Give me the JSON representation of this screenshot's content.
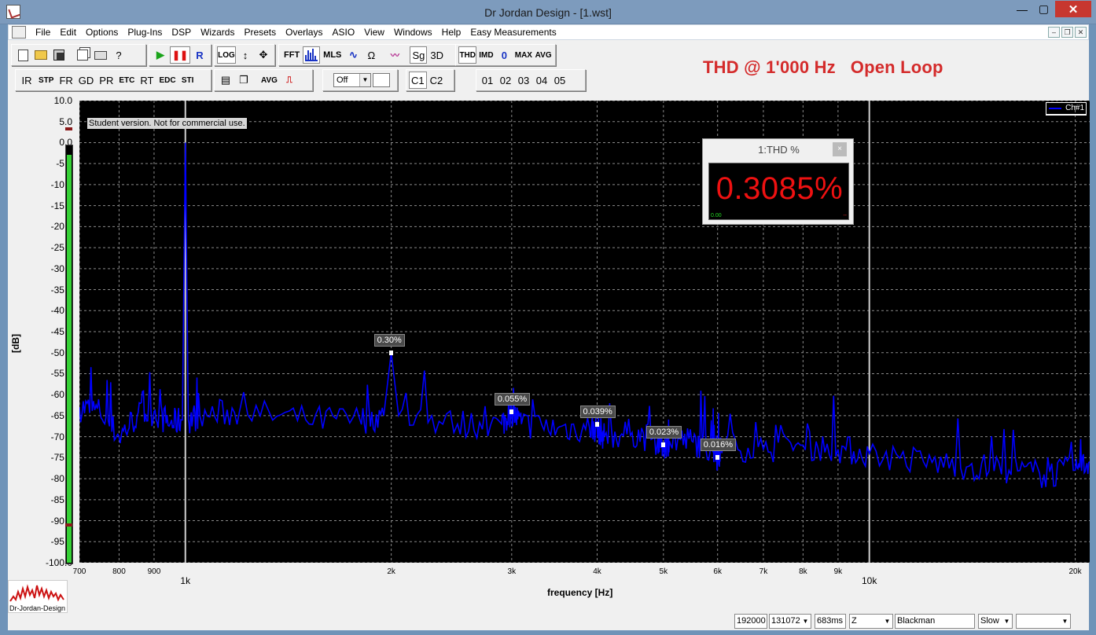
{
  "window": {
    "title": "Dr Jordan Design - [1.wst]",
    "minimize": "—",
    "maximize": "▢",
    "close": "✕"
  },
  "menu": [
    "File",
    "Edit",
    "Options",
    "Plug-Ins",
    "DSP",
    "Wizards",
    "Presets",
    "Overlays",
    "ASIO",
    "View",
    "Windows",
    "Help",
    "Easy Measurements"
  ],
  "mdi": {
    "minimize": "–",
    "restore": "❐",
    "close": "✕"
  },
  "toolbar1": {
    "log": "LOG",
    "fft": "FFT",
    "mls": "MLS",
    "ohm": "Ω",
    "sg": "Sg",
    "three_d": "3D",
    "thd": "THD",
    "imd": "IMD",
    "zero": "0",
    "max": "MAX",
    "avg": "AVG"
  },
  "toolbar2": {
    "buttons": [
      "IR",
      "STP",
      "FR",
      "GD",
      "PR",
      "ETC",
      "RT",
      "EDC",
      "STI"
    ],
    "avg": "AVG",
    "off_select": "Off",
    "channels": [
      "C1",
      "C2"
    ],
    "presets": [
      "01",
      "02",
      "03",
      "04",
      "05"
    ]
  },
  "headline": "THD @ 1'000 Hz   Open Loop",
  "plot": {
    "watermark": "Student version. Not for commercial use.",
    "legend": "Ch#1",
    "ylabel": "[dB]",
    "xlabel": "frequency [Hz]",
    "yticks": [
      "10.0",
      "5.0",
      "0.0",
      "-5.0",
      "-10.0",
      "-15.0",
      "-20.0",
      "-25.0",
      "-30.0",
      "-35.0",
      "-40.0",
      "-45.0",
      "-50.0",
      "-55.0",
      "-60.0",
      "-65.0",
      "-70.0",
      "-75.0",
      "-80.0",
      "-85.0",
      "-90.0",
      "-95.0",
      "-100.0"
    ],
    "minor_xticks": [
      "700",
      "800",
      "900",
      "2k",
      "3k",
      "4k",
      "5k",
      "6k",
      "7k",
      "8k",
      "9k",
      "20k"
    ],
    "major_xticks": [
      "1k",
      "10k"
    ],
    "harmonic_labels": [
      "0.30%",
      "0.055%",
      "0.039%",
      "0.023%",
      "0.016%"
    ],
    "line_color": "#0000ff",
    "background": "#000000"
  },
  "chart_data": {
    "type": "line",
    "x_scale": "log",
    "xlim": [
      700,
      21000
    ],
    "ylim": [
      -100,
      10
    ],
    "xlabel": "frequency [Hz]",
    "ylabel": "[dB]",
    "grid": true,
    "legend": "top-right",
    "series": [
      {
        "name": "Ch#1",
        "x": [
          700,
          750,
          800,
          850,
          900,
          950,
          990,
          1000,
          1010,
          1050,
          1200,
          1500,
          1800,
          1950,
          2000,
          2050,
          2500,
          2900,
          3000,
          3100,
          3500,
          3900,
          4000,
          4100,
          4500,
          4900,
          5000,
          5100,
          5500,
          5900,
          6000,
          6100,
          7000,
          8000,
          9000,
          10000,
          12000,
          14000,
          16000,
          18000,
          20000,
          21000
        ],
        "y": [
          -63,
          -64,
          -70,
          -65,
          -64,
          -67,
          -66,
          0,
          -66,
          -65,
          -64,
          -66,
          -66,
          -65,
          -50,
          -65,
          -67,
          -67,
          -64,
          -67,
          -68,
          -68,
          -68,
          -70,
          -69,
          -71,
          -72,
          -71,
          -71,
          -73,
          -75,
          -72,
          -73,
          -72,
          -73,
          -74,
          -76,
          -77,
          -78,
          -79,
          -78,
          -76
        ]
      }
    ],
    "harmonics": [
      {
        "x": 2000,
        "y": -50,
        "label": "0.30%"
      },
      {
        "x": 3000,
        "y": -64,
        "label": "0.055%"
      },
      {
        "x": 4000,
        "y": -67,
        "label": "0.039%"
      },
      {
        "x": 5000,
        "y": -72,
        "label": "0.023%"
      },
      {
        "x": 6000,
        "y": -75,
        "label": "0.016%"
      }
    ]
  },
  "meter": {
    "level_fraction": 0.98
  },
  "thd_panel": {
    "title": "1:THD %",
    "value": "0.3085%",
    "min": "0.00",
    "max": "--",
    "close": "×"
  },
  "logo": {
    "text": "Dr-Jordan-Design"
  },
  "statusbar": {
    "sample_rate": "192000",
    "fft_size": "131072",
    "duration": "683ms",
    "zoom": "Z",
    "window": "Blackman",
    "speed": "Slow",
    "blank": ""
  }
}
